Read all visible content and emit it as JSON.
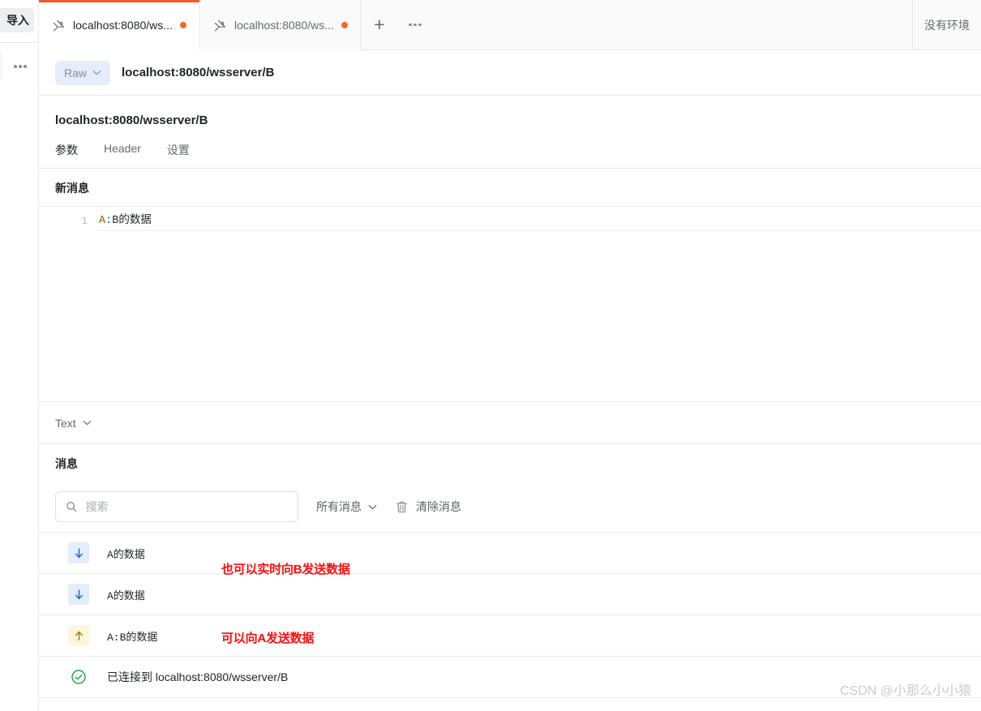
{
  "sidebar": {
    "import_label": "导入",
    "more_icon": "more-horizontal-icon"
  },
  "tabbar": {
    "tabs": [
      {
        "label": "localhost:8080/ws...",
        "icon": "websocket-icon",
        "dot": true,
        "active": true
      },
      {
        "label": "localhost:8080/ws...",
        "icon": "websocket-icon",
        "dot": true,
        "active": false
      }
    ],
    "add_label": "+",
    "more_icon": "more-horizontal-icon",
    "env_label": "没有环境"
  },
  "urlbar": {
    "method_label": "Raw",
    "url": "localhost:8080/wsserver/B"
  },
  "request": {
    "title": "localhost:8080/wsserver/B",
    "subtabs": [
      {
        "label": "参数",
        "active": true
      },
      {
        "label": "Header",
        "active": false
      },
      {
        "label": "设置",
        "active": false
      }
    ]
  },
  "new_message": {
    "section_title": "新消息",
    "line_number": "1",
    "content_key": "A",
    "content_colon": ":",
    "content_value": "B的数据",
    "content_full": "A:B的数据",
    "type_label": "Text"
  },
  "messages": {
    "section_title": "消息",
    "search_placeholder": "搜索",
    "search_value": "",
    "filter_label": "所有消息",
    "clear_label": "清除消息",
    "rows": [
      {
        "direction": "received",
        "icon": "arrow-down-icon",
        "text": "A的数据",
        "mono": true
      },
      {
        "direction": "received",
        "icon": "arrow-down-icon",
        "text": "A的数据",
        "mono": true
      },
      {
        "direction": "sent",
        "icon": "arrow-up-icon",
        "text": "A:B的数据",
        "mono": true
      },
      {
        "direction": "connected",
        "icon": "check-circle-icon",
        "text": "已连接到 localhost:8080/wsserver/B",
        "mono": false
      }
    ]
  },
  "annotations": [
    {
      "text": "也可以实时向B发送数据",
      "color": "#fa0d0d"
    },
    {
      "text": "可以向A发送数据",
      "color": "#fa0d0d"
    }
  ],
  "watermark": "CSDN @小那么小小猿",
  "colors": {
    "accent_orange": "#f05a28",
    "tab_dot": "#f5682a",
    "received_blue": "#1a5fd0",
    "sent_amber": "#a07a06",
    "connected_green": "#17a34a",
    "annotation_red": "#fa0d0d"
  }
}
